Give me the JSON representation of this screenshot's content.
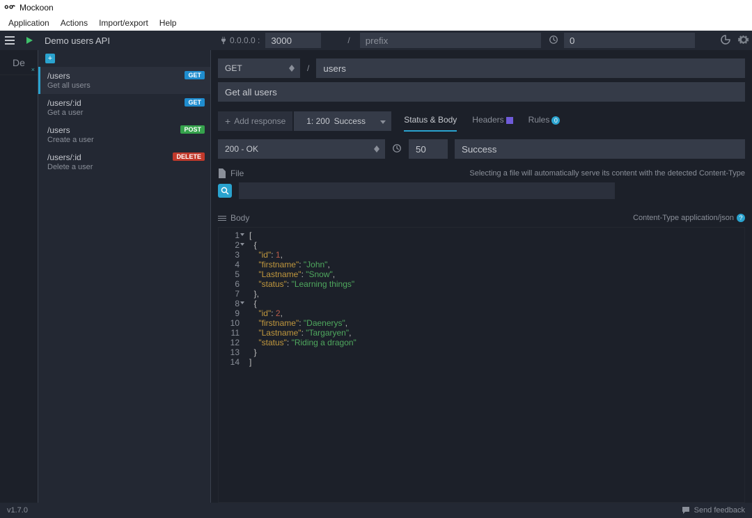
{
  "app_title": "Mockoon",
  "menubar": [
    "Application",
    "Actions",
    "Import/export",
    "Help"
  ],
  "topbar": {
    "api_name": "Demo users API",
    "host_label": "0.0.0.0 :",
    "port": "3000",
    "prefix_placeholder": "prefix",
    "latency": "0"
  },
  "env_chip": "De",
  "routes": [
    {
      "path": "/users",
      "desc": "Get all users",
      "method": "GET",
      "selected": true
    },
    {
      "path": "/users/:id",
      "desc": "Get a user",
      "method": "GET",
      "selected": false
    },
    {
      "path": "/users",
      "desc": "Create a user",
      "method": "POST",
      "selected": false
    },
    {
      "path": "/users/:id",
      "desc": "Delete a user",
      "method": "DELETE",
      "selected": false
    }
  ],
  "main": {
    "method": "GET",
    "slash": "/",
    "path": "users",
    "description": "Get all users",
    "add_response": "Add response",
    "response_selector": {
      "code": "1: 200",
      "label": "Success"
    },
    "tabs": {
      "status": "Status & Body",
      "headers": "Headers",
      "rules": "Rules"
    },
    "status_code": "200 - OK",
    "delay": "50",
    "comment": "Success",
    "file_label": "File",
    "file_note": "Selecting a file will automatically serve its content with the detected Content-Type",
    "body_label": "Body",
    "content_type": "Content-Type application/json"
  },
  "editor_lines": [
    {
      "n": "1",
      "fold": true,
      "t": [
        {
          "c": "tk-p",
          "v": "["
        }
      ]
    },
    {
      "n": "2",
      "fold": true,
      "t": [
        {
          "c": "tk-p",
          "v": "  {"
        }
      ]
    },
    {
      "n": "3",
      "t": [
        {
          "c": "tk-p",
          "v": "    "
        },
        {
          "c": "tk-k",
          "v": "\"id\""
        },
        {
          "c": "tk-p",
          "v": ": "
        },
        {
          "c": "tk-n",
          "v": "1"
        },
        {
          "c": "tk-p",
          "v": ","
        }
      ]
    },
    {
      "n": "4",
      "t": [
        {
          "c": "tk-p",
          "v": "    "
        },
        {
          "c": "tk-k",
          "v": "\"firstname\""
        },
        {
          "c": "tk-p",
          "v": ": "
        },
        {
          "c": "tk-s",
          "v": "\"John\""
        },
        {
          "c": "tk-p",
          "v": ","
        }
      ]
    },
    {
      "n": "5",
      "t": [
        {
          "c": "tk-p",
          "v": "    "
        },
        {
          "c": "tk-k",
          "v": "\"Lastname\""
        },
        {
          "c": "tk-p",
          "v": ": "
        },
        {
          "c": "tk-s",
          "v": "\"Snow\""
        },
        {
          "c": "tk-p",
          "v": ","
        }
      ]
    },
    {
      "n": "6",
      "t": [
        {
          "c": "tk-p",
          "v": "    "
        },
        {
          "c": "tk-k",
          "v": "\"status\""
        },
        {
          "c": "tk-p",
          "v": ": "
        },
        {
          "c": "tk-s",
          "v": "\"Learning things\""
        }
      ]
    },
    {
      "n": "7",
      "t": [
        {
          "c": "tk-p",
          "v": "  },"
        }
      ]
    },
    {
      "n": "8",
      "fold": true,
      "t": [
        {
          "c": "tk-p",
          "v": "  {"
        }
      ]
    },
    {
      "n": "9",
      "t": [
        {
          "c": "tk-p",
          "v": "    "
        },
        {
          "c": "tk-k",
          "v": "\"id\""
        },
        {
          "c": "tk-p",
          "v": ": "
        },
        {
          "c": "tk-n",
          "v": "2"
        },
        {
          "c": "tk-p",
          "v": ","
        }
      ]
    },
    {
      "n": "10",
      "t": [
        {
          "c": "tk-p",
          "v": "    "
        },
        {
          "c": "tk-k",
          "v": "\"firstname\""
        },
        {
          "c": "tk-p",
          "v": ": "
        },
        {
          "c": "tk-s",
          "v": "\"Daenerys\""
        },
        {
          "c": "tk-p",
          "v": ","
        }
      ]
    },
    {
      "n": "11",
      "t": [
        {
          "c": "tk-p",
          "v": "    "
        },
        {
          "c": "tk-k",
          "v": "\"Lastname\""
        },
        {
          "c": "tk-p",
          "v": ": "
        },
        {
          "c": "tk-s",
          "v": "\"Targaryen\""
        },
        {
          "c": "tk-p",
          "v": ","
        }
      ]
    },
    {
      "n": "12",
      "t": [
        {
          "c": "tk-p",
          "v": "    "
        },
        {
          "c": "tk-k",
          "v": "\"status\""
        },
        {
          "c": "tk-p",
          "v": ": "
        },
        {
          "c": "tk-s",
          "v": "\"Riding a dragon\""
        }
      ]
    },
    {
      "n": "13",
      "t": [
        {
          "c": "tk-p",
          "v": "  }"
        }
      ]
    },
    {
      "n": "14",
      "t": [
        {
          "c": "tk-p",
          "v": "]"
        }
      ]
    }
  ],
  "statusbar": {
    "version": "v1.7.0",
    "feedback": "Send feedback"
  }
}
